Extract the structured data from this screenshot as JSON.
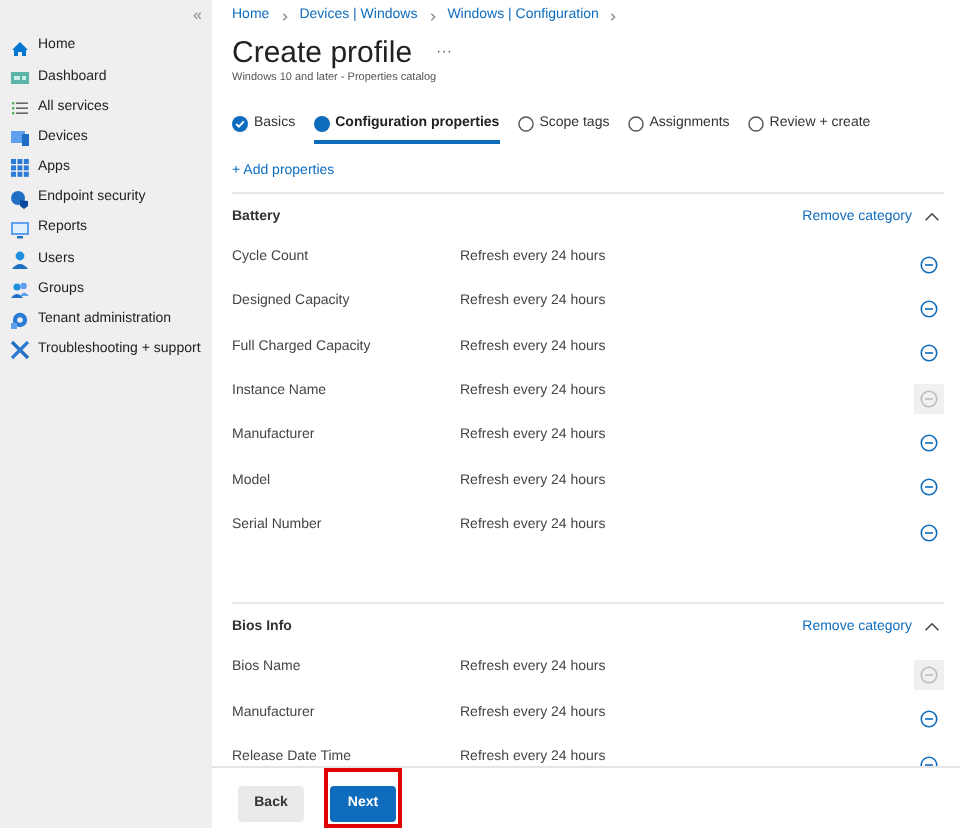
{
  "sidebar": {
    "collapse_glyph": "«",
    "items": [
      {
        "label": "Home"
      },
      {
        "label": "Dashboard"
      },
      {
        "label": "All services"
      },
      {
        "label": "Devices"
      },
      {
        "label": "Apps"
      },
      {
        "label": "Endpoint security"
      },
      {
        "label": "Reports"
      },
      {
        "label": "Users"
      },
      {
        "label": "Groups"
      },
      {
        "label": "Tenant administration"
      },
      {
        "label": "Troubleshooting + support"
      }
    ]
  },
  "breadcrumb": [
    "Home",
    "Devices | Windows",
    "Windows | Configuration"
  ],
  "title": "Create profile",
  "more": "···",
  "subtitle": "Windows 10 and later - Properties catalog",
  "tabs": [
    {
      "label": "Basics",
      "kind": "done",
      "selected": false
    },
    {
      "label": "Configuration properties",
      "kind": "current",
      "selected": true
    },
    {
      "label": "Scope tags",
      "kind": "pending",
      "selected": false
    },
    {
      "label": "Assignments",
      "kind": "pending",
      "selected": false
    },
    {
      "label": "Review + create",
      "kind": "pending",
      "selected": false
    }
  ],
  "add_properties": "+ Add properties",
  "categories": [
    {
      "name": "Battery",
      "remove": "Remove category",
      "expanded": true,
      "rows": [
        {
          "name": "Cycle Count",
          "value": "Refresh every 24 hours",
          "disabled": false
        },
        {
          "name": "Designed Capacity",
          "value": "Refresh every 24 hours",
          "disabled": false
        },
        {
          "name": "Full Charged Capacity",
          "value": "Refresh every 24 hours",
          "disabled": false
        },
        {
          "name": "Instance Name",
          "value": "Refresh every 24 hours",
          "disabled": true
        },
        {
          "name": "Manufacturer",
          "value": "Refresh every 24 hours",
          "disabled": false
        },
        {
          "name": "Model",
          "value": "Refresh every 24 hours",
          "disabled": false
        },
        {
          "name": "Serial Number",
          "value": "Refresh every 24 hours",
          "disabled": false
        }
      ]
    },
    {
      "name": "Bios Info",
      "remove": "Remove category",
      "expanded": true,
      "rows": [
        {
          "name": "Bios Name",
          "value": "Refresh every 24 hours",
          "disabled": true
        },
        {
          "name": "Manufacturer",
          "value": "Refresh every 24 hours",
          "disabled": false
        },
        {
          "name": "Release Date Time",
          "value": "Refresh every 24 hours",
          "disabled": false
        }
      ]
    }
  ],
  "buttons": [
    {
      "label": "Back",
      "kind": "secondary",
      "highlighted": false
    },
    {
      "label": "Next",
      "kind": "primary",
      "highlighted": true
    }
  ]
}
